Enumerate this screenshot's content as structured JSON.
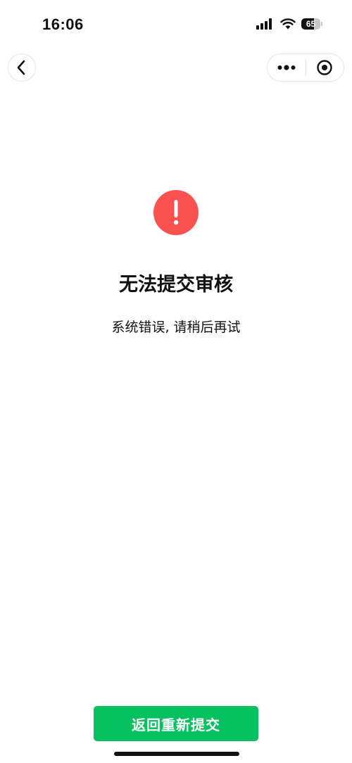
{
  "status_bar": {
    "time": "16:06",
    "battery_level": "65",
    "icons": [
      "signal-icon",
      "wifi-icon",
      "battery-icon"
    ]
  },
  "nav": {
    "back_icon": "chevron-left-icon",
    "more_icon": "more-dots-icon",
    "close_icon": "target-close-icon"
  },
  "result": {
    "icon": "exclamation-icon",
    "title": "无法提交审核",
    "message": "系统错误, 请稍后再试"
  },
  "actions": {
    "primary_label": "返回重新提交"
  },
  "colors": {
    "error": "#fa5151",
    "primary": "#07c160",
    "text": "#111111",
    "background": "#ffffff"
  }
}
